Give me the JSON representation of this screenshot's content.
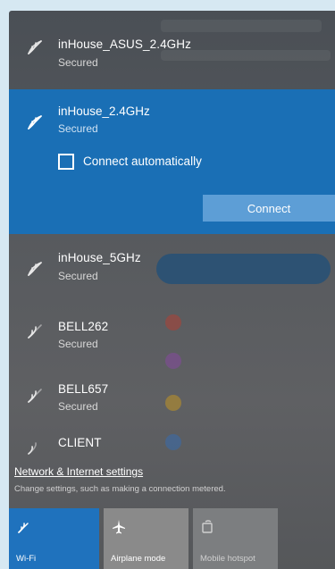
{
  "networks": [
    {
      "name": "inHouse_ASUS_2.4GHz",
      "status": "Secured"
    },
    {
      "name": "inHouse_5GHz",
      "status": "Secured"
    },
    {
      "name": "BELL262",
      "status": "Secured"
    },
    {
      "name": "BELL657",
      "status": "Secured"
    },
    {
      "name": "CLIENT",
      "status": ""
    }
  ],
  "selected_network": {
    "name": "inHouse_2.4GHz",
    "status": "Secured",
    "auto_connect_label": "Connect automatically",
    "auto_connect_checked": false,
    "connect_label": "Connect"
  },
  "footer": {
    "settings_link": "Network & Internet settings",
    "settings_desc": "Change settings, such as making a connection metered."
  },
  "quick_actions": {
    "wifi_label": "Wi-Fi",
    "airplane_label": "Airplane mode",
    "hotspot_label": "Mobile hotspot"
  },
  "colors": {
    "accent": "#1a6fb5",
    "connect_button": "#5d9ed6",
    "panel_bg": "#55585c"
  },
  "icons": {
    "network": "wifi-signal-icon",
    "airplane": "airplane-icon",
    "hotspot": "hotspot-icon"
  }
}
